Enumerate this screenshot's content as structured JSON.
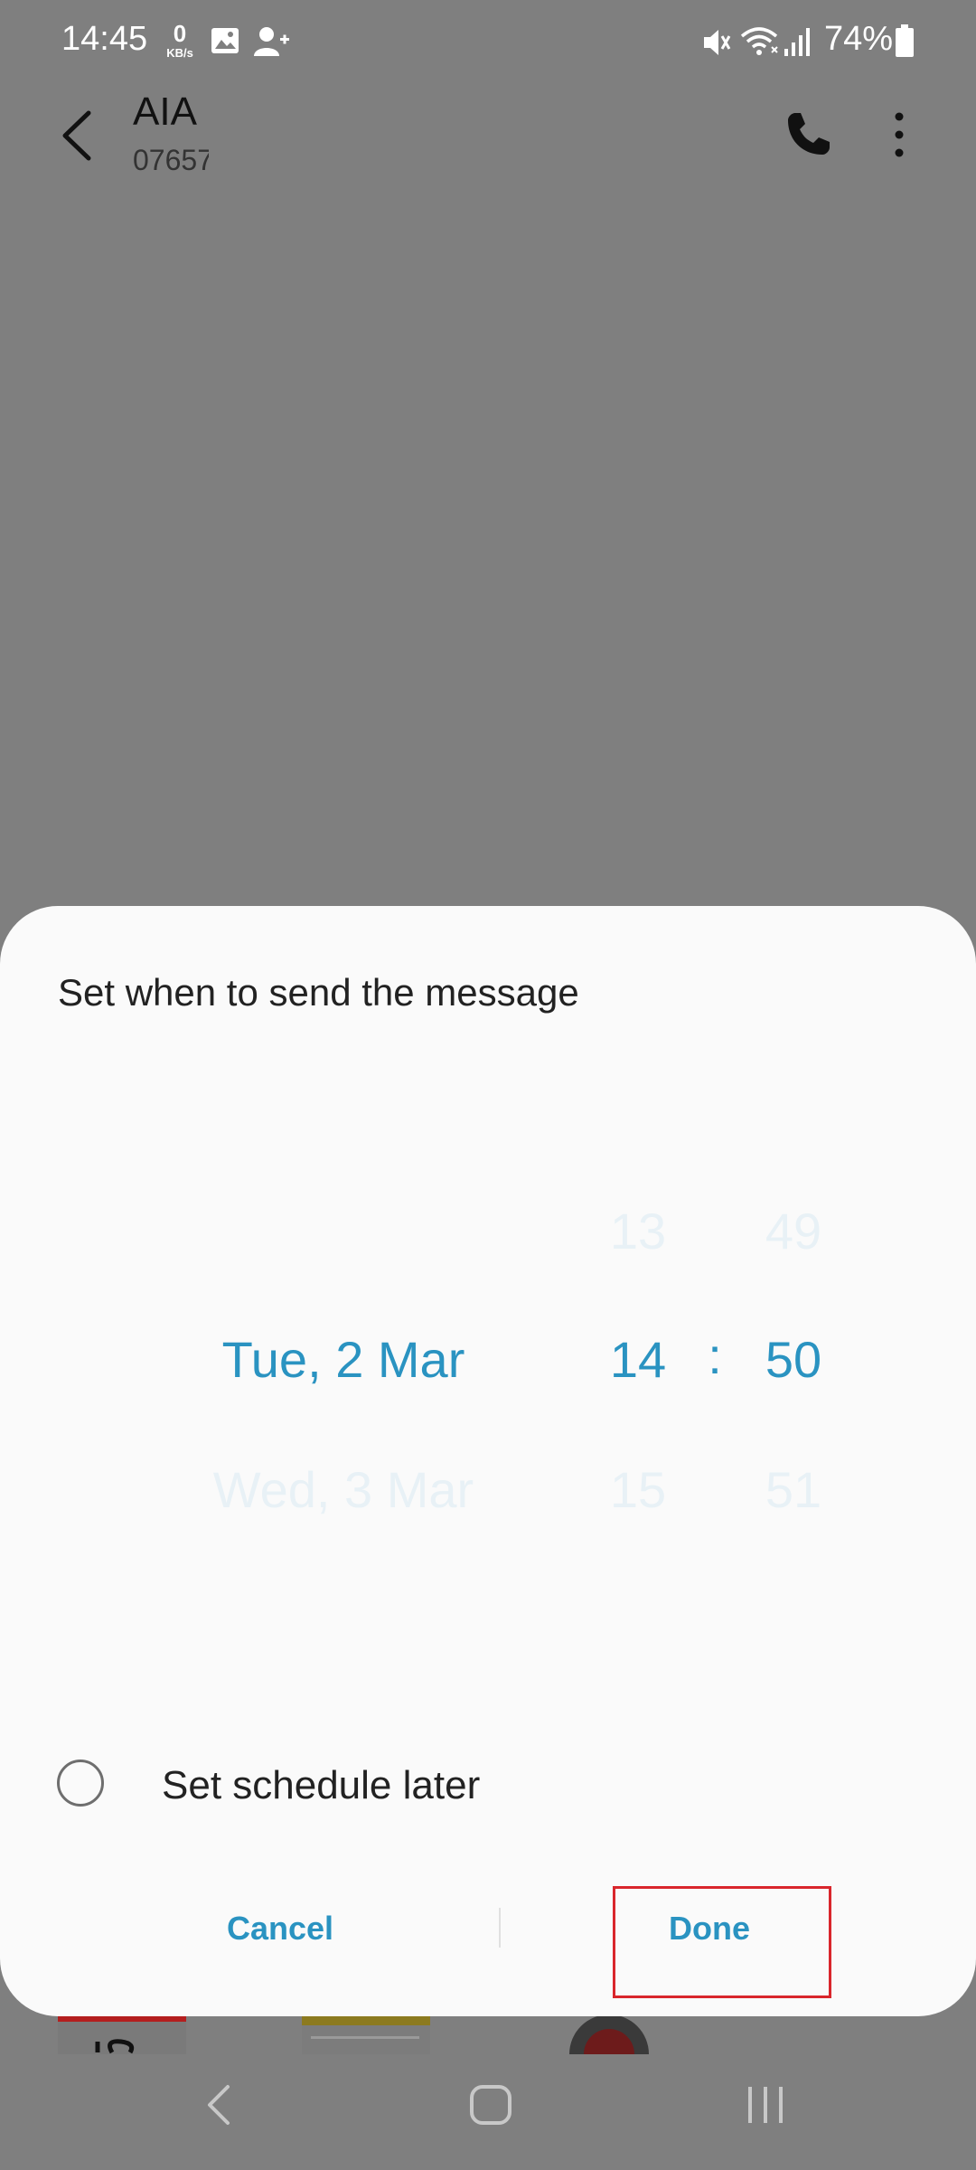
{
  "status_bar": {
    "time": "14:45",
    "net_speed_value": "0",
    "net_speed_unit": "KB/s",
    "battery_percent": "74%",
    "icons": [
      "gallery-icon",
      "contact-icon",
      "mute-icon",
      "wifi-icon",
      "signal-icon",
      "battery-icon"
    ]
  },
  "header": {
    "contact_name": "AIA",
    "contact_number": "07657",
    "icons": [
      "back-icon",
      "phone-icon",
      "more-options-icon"
    ]
  },
  "dialog": {
    "title": "Set when to send the message",
    "date_picker": {
      "above": "",
      "selected": "Tue, 2 Mar",
      "below": "Wed, 3 Mar"
    },
    "hour_picker": {
      "above": "13",
      "selected": "14",
      "below": "15"
    },
    "time_separator": ":",
    "minute_picker": {
      "above": "49",
      "selected": "50",
      "below": "51"
    },
    "schedule_later_label": "Set schedule later",
    "schedule_later_checked": false,
    "cancel_label": "Cancel",
    "done_label": "Done"
  },
  "colors": {
    "accent": "#2a93c1",
    "scrim": "#7f7f7f",
    "dialog_bg": "#fafafa",
    "highlight_box": "#d9262c"
  },
  "nav_bar": {
    "icons": [
      "nav-back-icon",
      "nav-home-icon",
      "nav-recents-icon"
    ]
  }
}
